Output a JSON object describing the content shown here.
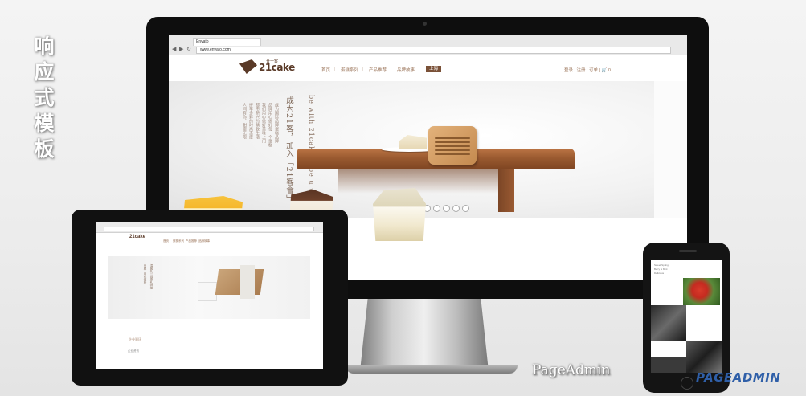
{
  "title_vertical": [
    "响",
    "应",
    "式",
    "模",
    "板"
  ],
  "browser": {
    "tab_label": "Envato",
    "url": "www.envato.com",
    "nav_icons": [
      "◀",
      "▶",
      "↻"
    ]
  },
  "site": {
    "logo": "21cake",
    "logo_sub": "廿一客",
    "nav": [
      "首页",
      "蛋糕系列",
      "产品推荐",
      "品牌故事"
    ],
    "city": "上海",
    "header_right": "登录 | 注册 | 订单 | 🛒 0",
    "hero_vertical_en": "be with 21cake & be u well",
    "hero_vertical_cn": "成为21客，加入「21客會」",
    "hero_vertical_small": [
      "成为国际品牌蛋糕品牌",
      "品牌用心做好每一个蛋糕",
      "我们用心做好美味上门",
      "都市新兴的精致生活",
      "拼车多彩的时尚态度",
      "人间有你，甜蜜无限"
    ],
    "carousel_dots": [
      false,
      true,
      false,
      false,
      false,
      false,
      false
    ],
    "products": [
      "cheese-cake",
      "tiramisu",
      "coconut-cake"
    ]
  },
  "tablet": {
    "logo": "21cake",
    "nav": [
      "首页",
      "蛋糕系列",
      "产品推荐",
      "品牌故事"
    ],
    "hero_vertical": [
      "温馨礼 | 健康礼物加",
      "品牌 · 用心做好"
    ],
    "section_title": "企业资讯",
    "section_text": "企业资讯"
  },
  "phone": {
    "text_lines": [
      "Sweet Spring",
      "Berry & Mint",
      "Delicious"
    ]
  },
  "watermark": {
    "pageadmin_text": "PageAdmin",
    "pageadmin_logo": "PAGEADMIN"
  },
  "colors": {
    "brand_brown": "#5a3a28",
    "nav_brown": "#9a7358",
    "logo_blue": "#2f5fa8"
  }
}
